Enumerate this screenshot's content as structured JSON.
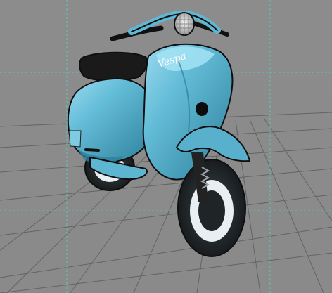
{
  "viewport": {
    "background_color": "#8b8b8b",
    "grid_color": "#5a5a5a",
    "guide_color": "#55c8b8"
  },
  "model": {
    "brand_text": "Vespa",
    "body_color": "#5fb7d3",
    "body_shadow_color": "#2f7f9c",
    "body_highlight_color": "#8fd3ea",
    "tire_color": "#1f2427",
    "whitewall_color": "#e8eef1",
    "seat_color": "#1a1a1a"
  }
}
